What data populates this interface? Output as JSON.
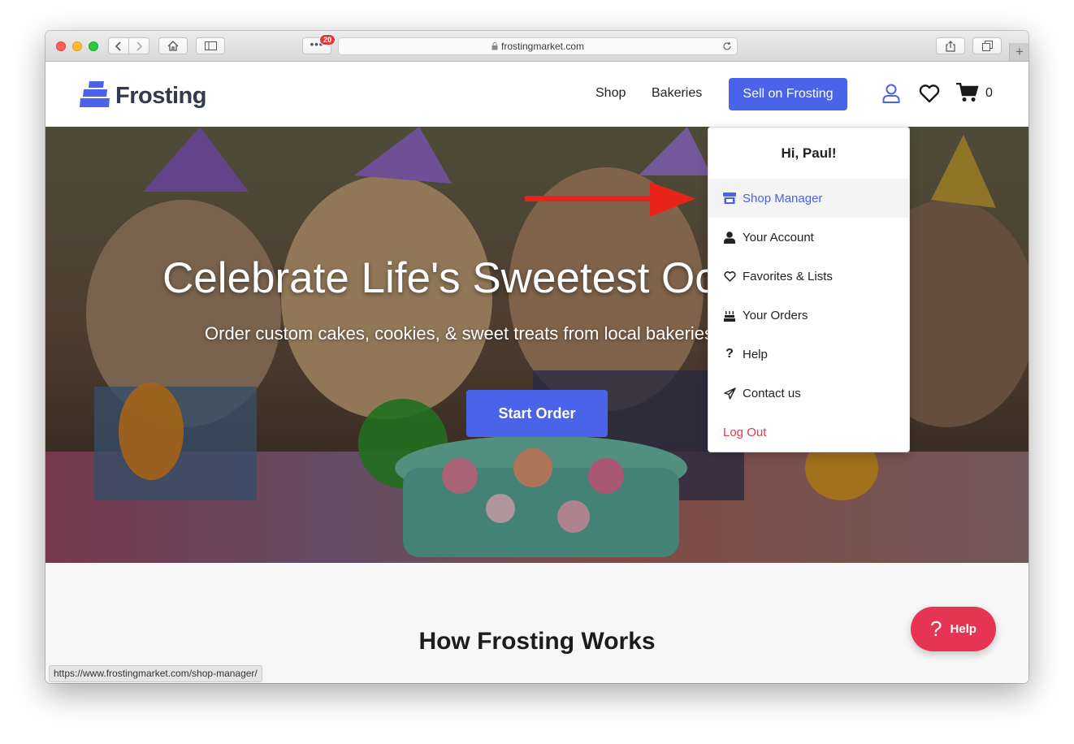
{
  "browser": {
    "url": "frostingmarket.com",
    "tabs_badge": "20",
    "status_url": "https://www.frostingmarket.com/shop-manager/"
  },
  "header": {
    "logo_text": "Frosting",
    "nav": {
      "shop": "Shop",
      "bakeries": "Bakeries"
    },
    "sell_button": "Sell on Frosting",
    "cart_count": "0"
  },
  "hero": {
    "title": "Celebrate Life's Sweetest Occasions",
    "subtitle": "Order custom cakes, cookies, & sweet treats from local bakeries",
    "cta": "Start Order"
  },
  "dropdown": {
    "greeting": "Hi, Paul!",
    "items": [
      {
        "label": "Shop Manager",
        "icon": "store-icon"
      },
      {
        "label": "Your Account",
        "icon": "user-icon"
      },
      {
        "label": "Favorites & Lists",
        "icon": "heart-icon"
      },
      {
        "label": "Your Orders",
        "icon": "cake-icon"
      },
      {
        "label": "Help",
        "icon": "question-icon"
      },
      {
        "label": "Contact us",
        "icon": "paper-plane-icon"
      }
    ],
    "logout": "Log Out"
  },
  "section": {
    "how_title": "How Frosting Works"
  },
  "help_widget": {
    "label": "Help",
    "icon": "?"
  },
  "colors": {
    "brand": "#4a63e8",
    "danger": "#e63553",
    "annotation_arrow": "#e8231a"
  }
}
